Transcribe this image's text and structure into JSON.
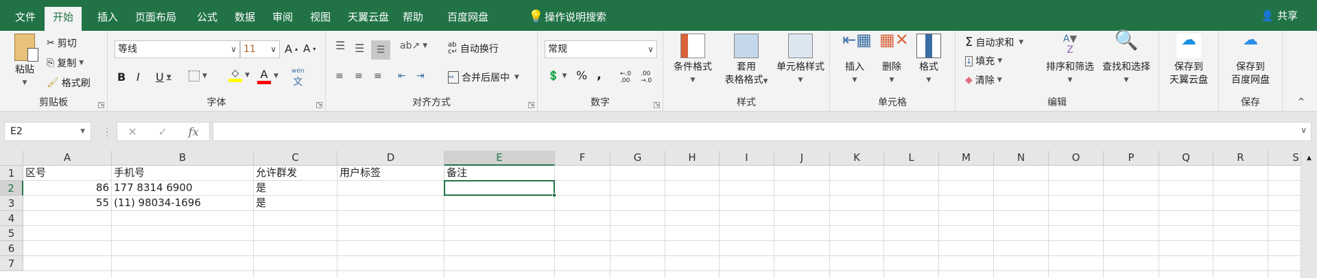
{
  "tabs": [
    "文件",
    "开始",
    "插入",
    "页面布局",
    "公式",
    "数据",
    "审阅",
    "视图",
    "天翼云盘",
    "帮助",
    "百度网盘"
  ],
  "active_tab": "开始",
  "tell_me": "操作说明搜索",
  "share": "共享",
  "clipboard": {
    "paste": "粘贴",
    "cut": "剪切",
    "copy": "复制",
    "format_painter": "格式刷",
    "label": "剪贴板"
  },
  "font": {
    "name": "等线",
    "size": "11",
    "bold": "B",
    "italic": "I",
    "underline": "U",
    "font_color": "A",
    "phonetic": "wén",
    "label": "字体",
    "highlight_color": "#ffff00",
    "text_color": "#ff0000"
  },
  "alignment": {
    "wrap": "自动换行",
    "merge": "合并后居中",
    "label": "对齐方式"
  },
  "number": {
    "format": "常规",
    "percent": "%",
    "comma": ",",
    "label": "数字"
  },
  "styles": {
    "conditional": "条件格式",
    "table1": "套用",
    "table2": "表格格式",
    "cell_styles": "单元格样式",
    "label": "样式"
  },
  "cells": {
    "insert": "插入",
    "delete": "删除",
    "format": "格式",
    "label": "单元格"
  },
  "editing": {
    "autosum": "自动求和",
    "fill": "填充",
    "clear": "清除",
    "sort": "排序和筛选",
    "find": "查找和选择",
    "label": "编辑"
  },
  "cloud": {
    "tianyi1": "保存到",
    "tianyi2": "天翼云盘",
    "baidu1": "保存到",
    "baidu2": "百度网盘",
    "label": "保存"
  },
  "formula_bar": {
    "name_box": "E2",
    "cancel": "✕",
    "enter": "✓",
    "fx": "fx",
    "value": ""
  },
  "sheet": {
    "columns": [
      "A",
      "B",
      "C",
      "D",
      "E",
      "F",
      "G",
      "H",
      "I",
      "J",
      "K",
      "L",
      "M",
      "N",
      "O",
      "P",
      "Q",
      "R",
      "S"
    ],
    "rows": [
      "1",
      "2",
      "3",
      "4",
      "5",
      "6",
      "7"
    ],
    "selected_cell": "E2",
    "cells": [
      [
        "区号",
        "手机号",
        "允许群发",
        "用户标签",
        "备注"
      ],
      [
        "86",
        "177 8314 6900",
        "是",
        "",
        ""
      ],
      [
        "55",
        "(11) 98034-1696",
        "是",
        "",
        ""
      ]
    ]
  }
}
